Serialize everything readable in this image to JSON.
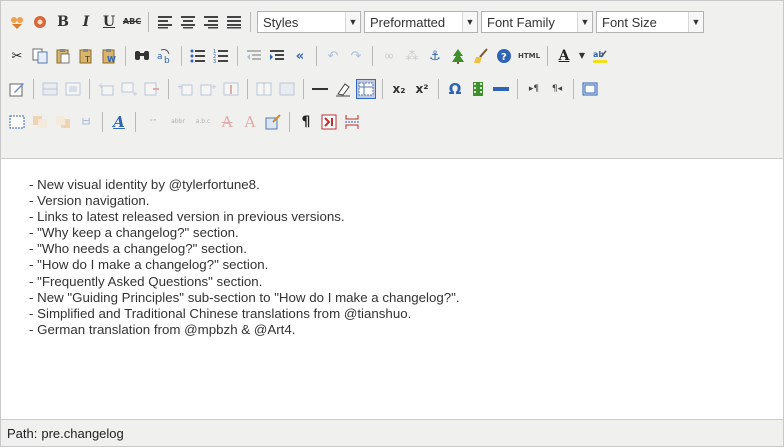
{
  "toolbar": {
    "selects": {
      "styles": "Styles",
      "format": "Preformatted",
      "font_family": "Font Family",
      "font_size": "Font Size"
    },
    "text_icons": {
      "bold": "B",
      "italic": "I",
      "underline": "U",
      "strikethrough": "ABC",
      "html": "HTML",
      "omega": "Ω",
      "pilcrow": "¶",
      "subscript": "x₂",
      "superscript": "x²",
      "font_color": "A",
      "style_props": "A"
    }
  },
  "content": {
    "lines": [
      "- New visual identity by @tylerfortune8.",
      "- Version navigation.",
      "- Links to latest released version in previous versions.",
      "- \"Why keep a changelog?\" section.",
      "- \"Who needs a changelog?\" section.",
      "- \"How do I make a changelog?\" section.",
      "- \"Frequently Asked Questions\" section.",
      "- New \"Guiding Principles\" sub-section to \"How do I make a changelog?\".",
      "- Simplified and Traditional Chinese translations from @tianshuo.",
      "- German translation from @mpbzh & @Art4."
    ]
  },
  "statusbar": {
    "label": "Path:",
    "path": "pre.changelog"
  },
  "colors": {
    "toolbar_bg": "#f0f0ee",
    "active_button": "#c2cbe0",
    "text": "#333333"
  }
}
